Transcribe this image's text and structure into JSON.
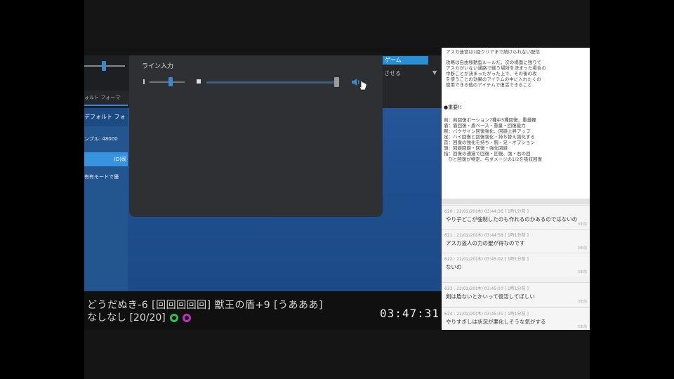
{
  "dialog": {
    "title": "ライン入力"
  },
  "background_window": {
    "highlight": "ゲーム",
    "dropdown_label": "させる",
    "tab_label": "ォルト フォーマ",
    "panel_heading": "デフォルト フォ",
    "sample_rate": "ンプル: 48000",
    "button_label": "(D)既",
    "exclusive_mode": "有有モードで優"
  },
  "hud": {
    "line1": "どうだぬき-6 [回回回回回] 獣王の盾+9 [うあああ]",
    "line2": "なしなし [20/20]",
    "time": "03:47:31"
  },
  "notes": {
    "lines": [
      "アスカ迷宮は1回クリアまで続けられない配信",
      "攻略は自由移動型ルールだ。次の場面に残りて",
      "アスカがいない通路で戦う場所を決まった場合の",
      "中断ことが決まったがった上で、その後の攻",
      "を使うことの効果のアイテムの中に入れたくの",
      "使用できる他のアイテムで復活できること"
    ],
    "heading": "●重要!!",
    "items": [
      "剣：剣回復ポーション7種中5種回復、重量軽",
      "盾：盾回復・盾ベース・重量・回復能力",
      "腕：バクサイン回復強化、回避上昇アップ",
      "足：ハイ回復と回復強化・持ち替え強化する",
      "首：回復の強化を持ち・腕・足・オプション",
      "頭：回避回避・回復・強化回避",
      "指：回復の通過で回復・回復、強・右の回",
      "　ひと回復が特定、与ダメージの1/2を吸収回復"
    ]
  },
  "comments": [
    {
      "meta": "620 : 22/02/20(木) 03:44:36 [ 1時1分前 ]",
      "body": "やり子どこが強制したのも作れるのかあるのではないの",
      "ago": "3年前"
    },
    {
      "meta": "621 : 22/02/20(木) 03:44:58 [ 1時1分前 ]",
      "body": "アスカ盗人の力の聖が得なのです",
      "ago": "3年前"
    },
    {
      "meta": "622 : 22/02/20(木) 03:45:02 [ 1時1分前 ]",
      "body": "ないの",
      "ago": "3年前"
    },
    {
      "meta": "623 : 22/02/20(木) 03:45:10 [ 1時1分前 ]",
      "body": "剣は盾ないとかいって復活してほしい",
      "ago": "3年前"
    },
    {
      "meta": "624 : 22/02/20(木) 03:45:31 [ 1時1分前 ]",
      "body": "やりすぎしは状況が悪化しそうな気がする",
      "ago": "3年前"
    }
  ],
  "colors": {
    "accent": "#3a8ad0",
    "desktop": "#2a5b9c",
    "ring_green": "#2fbf4a",
    "ring_magenta": "#c030c0"
  },
  "icons": [
    "speaker-icon",
    "cursor-icon"
  ]
}
